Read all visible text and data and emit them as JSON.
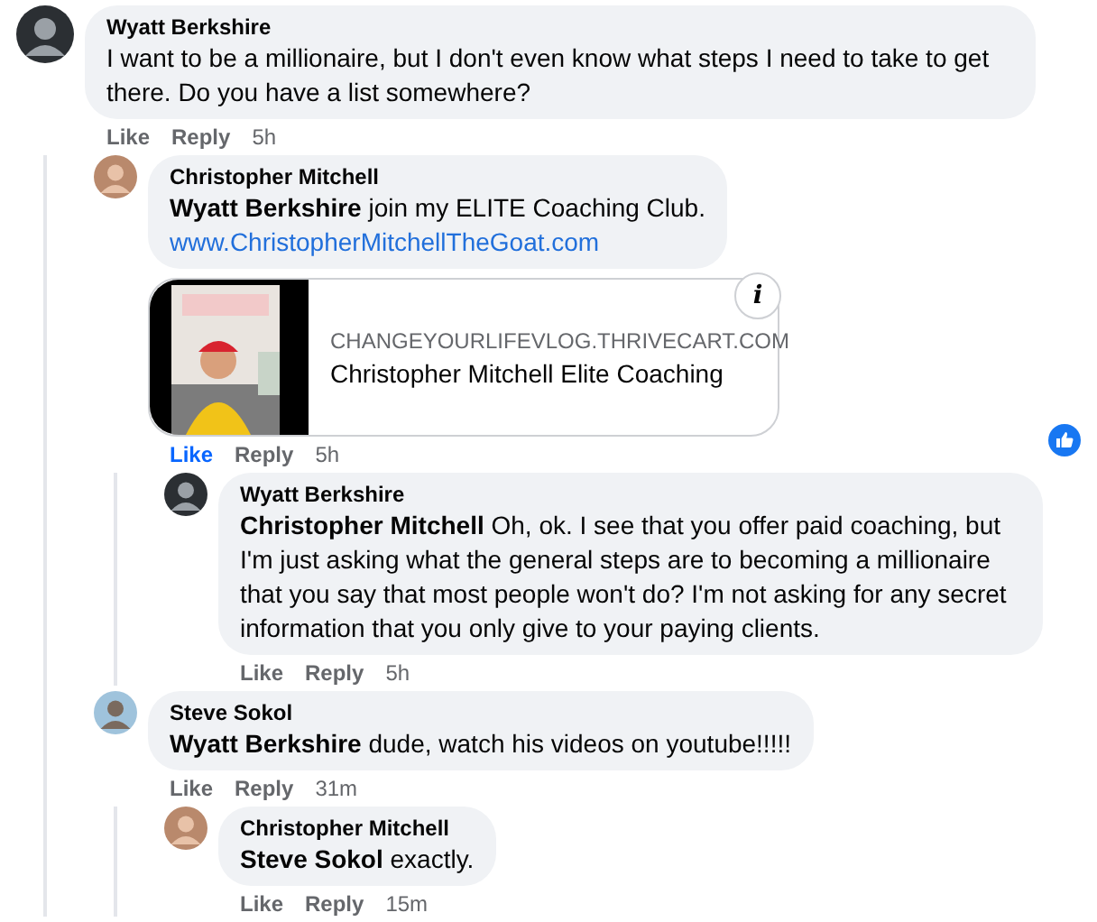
{
  "comments": [
    {
      "author": "Wyatt Berkshire",
      "avatar": {
        "kind": "dark"
      },
      "text": "I want to be a millionaire, but I don't even know what steps I need to take to get there. Do you have a list somewhere?",
      "actions": {
        "like": "Like",
        "reply": "Reply",
        "time": "5h",
        "liked": false
      },
      "children": [
        {
          "author": "Christopher Mitchell",
          "avatar": {
            "kind": "warm"
          },
          "text": "**Wyatt Berkshire** join my ELITE Coaching Club.",
          "link": "www.ChristopherMitchellTheGoat.com",
          "card": {
            "domain": "CHANGEYOURLIFEVLOG.THRIVECART.COM",
            "title": "Christopher Mitchell Elite Coaching",
            "info": "i"
          },
          "has_reaction": true,
          "actions": {
            "like": "Like",
            "reply": "Reply",
            "time": "5h",
            "liked": true
          },
          "children": [
            {
              "author": "Wyatt Berkshire",
              "avatar": {
                "kind": "dark"
              },
              "text": "**Christopher Mitchell** Oh, ok. I see that you offer paid coaching, but I'm just asking what the general steps are to becoming a millionaire that you say that most people won't do? I'm not asking for any secret information that you only give to your paying clients.",
              "actions": {
                "like": "Like",
                "reply": "Reply",
                "time": "5h",
                "liked": false
              }
            }
          ]
        },
        {
          "author": "Steve Sokol",
          "avatar": {
            "kind": "sky"
          },
          "text": "**Wyatt Berkshire** dude, watch his videos on youtube!!!!!",
          "actions": {
            "like": "Like",
            "reply": "Reply",
            "time": "31m",
            "liked": false
          },
          "children": [
            {
              "author": "Christopher Mitchell",
              "avatar": {
                "kind": "warm"
              },
              "text": "**Steve Sokol** exactly.",
              "actions": {
                "like": "Like",
                "reply": "Reply",
                "time": "15m",
                "liked": false
              }
            }
          ]
        }
      ]
    }
  ]
}
